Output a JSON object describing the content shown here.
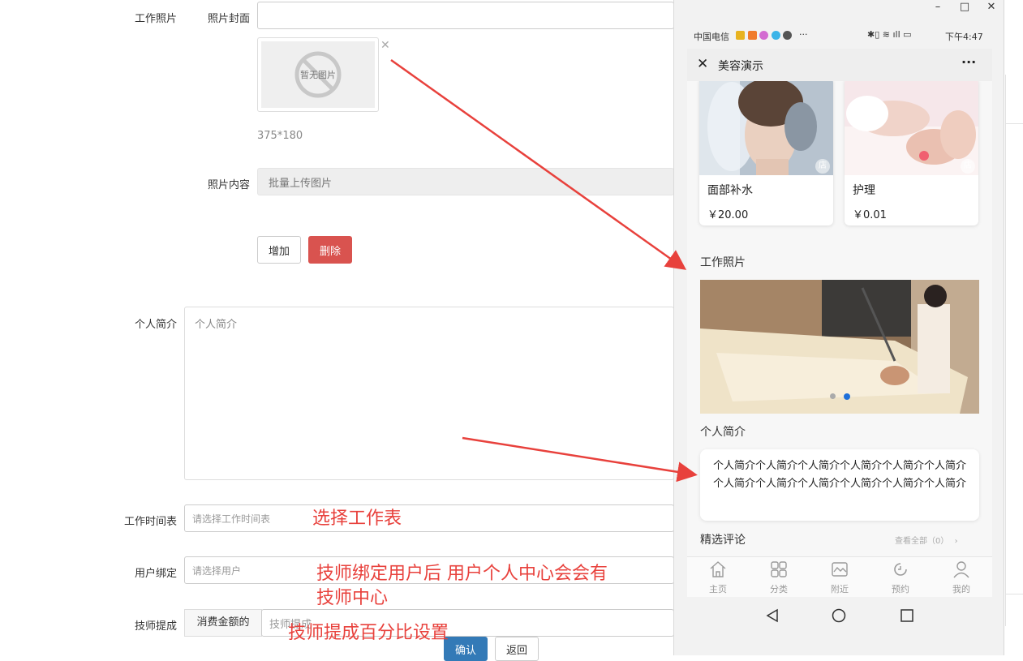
{
  "form": {
    "work_photo_label": "工作照片",
    "cover_label": "照片封面",
    "no_image_text": "暂无图片",
    "size_hint": "375*180",
    "content_label": "照片内容",
    "batch_upload": "批量上传图片",
    "add_button": "增加",
    "delete_button": "删除",
    "bio_label": "个人简介",
    "bio_placeholder": "个人简介",
    "schedule_label": "工作时间表",
    "schedule_placeholder": "请选择工作时间表",
    "user_bind_label": "用户绑定",
    "user_bind_placeholder": "请选择用户",
    "commission_label": "技师提成",
    "commission_mode": "消费金额的",
    "commission_placeholder": "技师提成",
    "confirm_button": "确认",
    "back_button": "返回"
  },
  "annotations": {
    "select_schedule": "选择工作表",
    "bind_line1": "技师绑定用户后  用户个人中心会会有",
    "bind_line2": "技师中心",
    "commission_note": "技师提成百分比设置"
  },
  "phone": {
    "window_controls": [
      "–",
      "□",
      "✕"
    ],
    "carrier": "中国电信",
    "status_dots": "···",
    "time": "下午4:47",
    "nav_title": "美容演示",
    "more": "···",
    "products": [
      {
        "name": "面部补水",
        "price": "￥20.00",
        "tag": "店"
      },
      {
        "name": "护理",
        "price": "￥0.01",
        "tag": "店"
      }
    ],
    "work_photo_title": "工作照片",
    "bio_title": "个人简介",
    "bio_text": "个人简介个人简介个人简介个人简介个人简介个人简介 个人简介个人简介个人简介个人简介个人简介个人简介",
    "reviews_title": "精选评论",
    "view_all": "查看全部（0）",
    "tabs": [
      {
        "label": "主页",
        "icon": "home-icon"
      },
      {
        "label": "分类",
        "icon": "category-icon"
      },
      {
        "label": "附近",
        "icon": "nearby-icon"
      },
      {
        "label": "预约",
        "icon": "booking-icon"
      },
      {
        "label": "我的",
        "icon": "profile-icon"
      }
    ]
  },
  "colors": {
    "danger": "#d9534f",
    "primary": "#337ab7",
    "annotation": "#e8413c",
    "active_dot": "#1e6fd9"
  }
}
